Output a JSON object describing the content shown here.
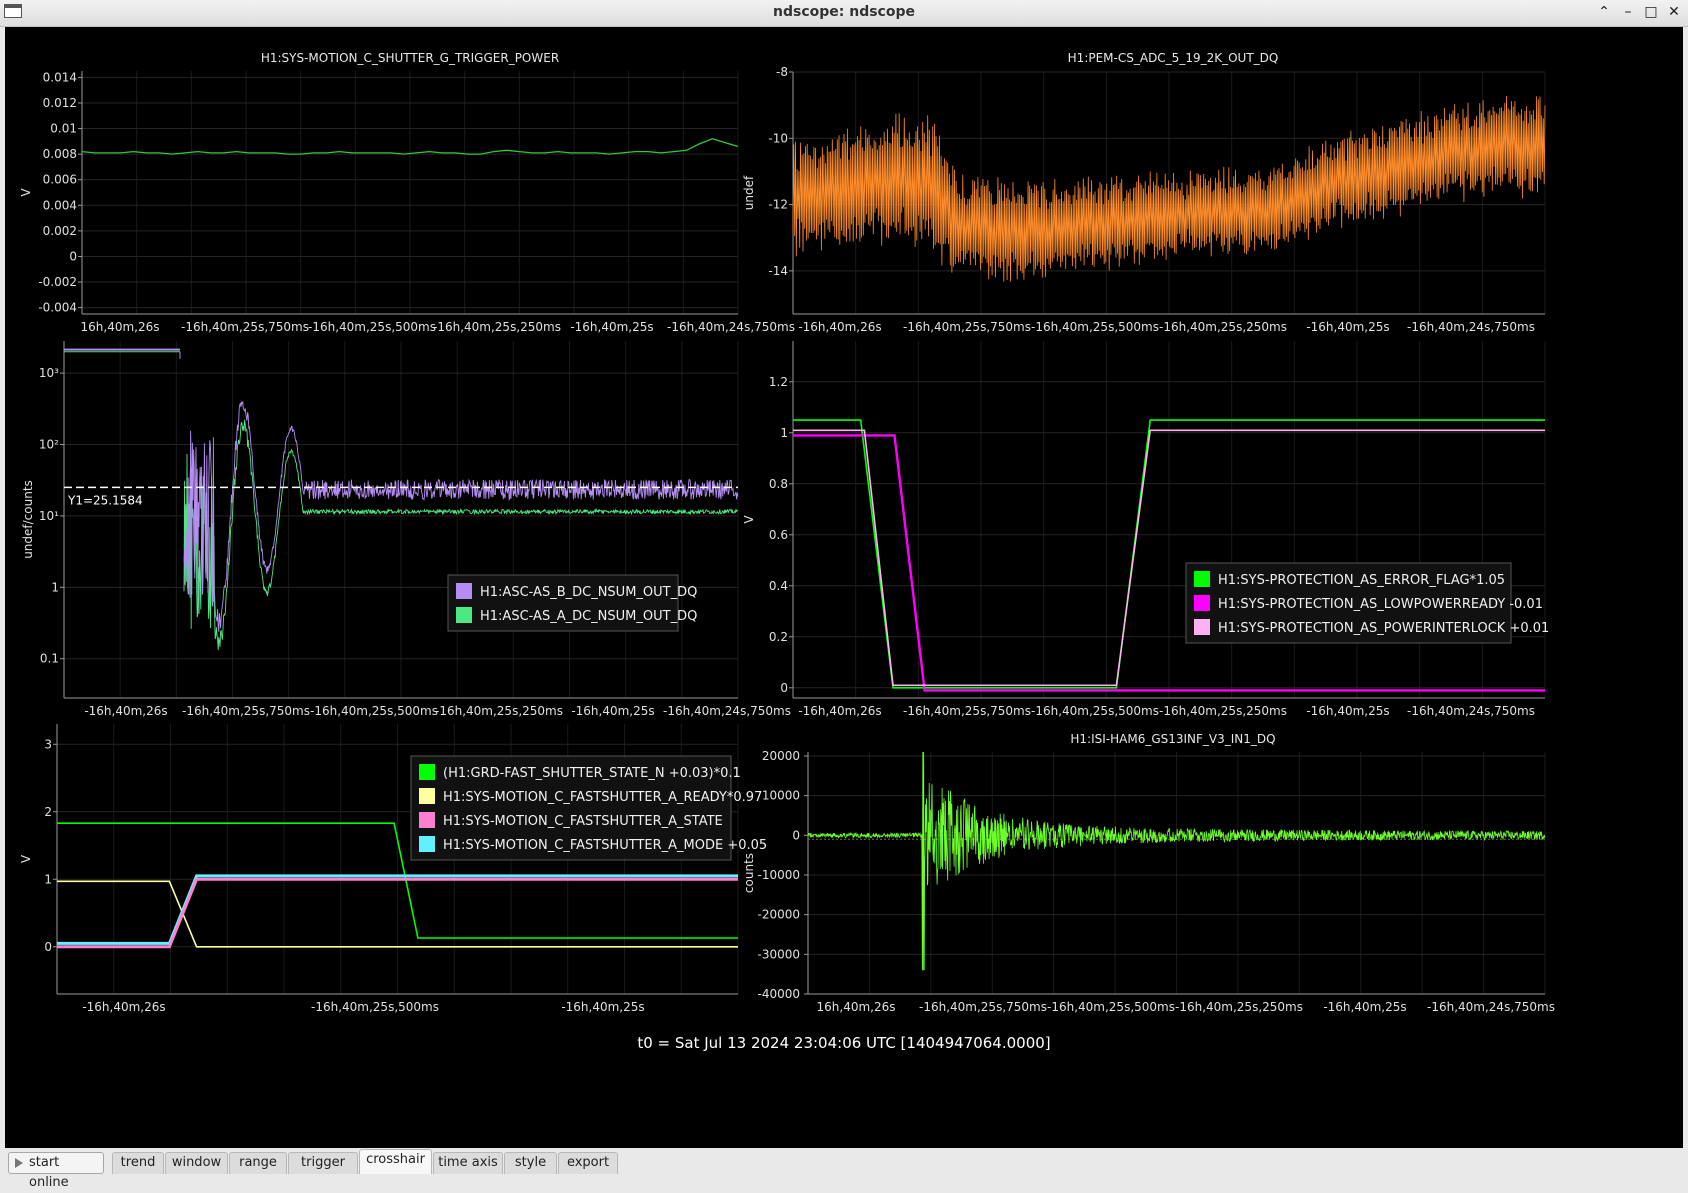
{
  "window": {
    "title": "ndscope: ndscope",
    "controls": [
      "⌃",
      "–",
      "□",
      "✕"
    ]
  },
  "colors": {
    "background": "#000000",
    "trace_green": "#31c83a",
    "trace_orange": "#ff8c2a",
    "trace_violet": "#b48cf2",
    "trace_mint": "#4ee882",
    "bright_green": "#00ff00",
    "magenta": "#ff00ff",
    "pink": "#ffb0f2",
    "yellow": "#ffffa0",
    "rose": "#ff80d0",
    "cyan": "#60f0ff",
    "lime": "#6cff2a"
  },
  "footer": {
    "t0": "t0 = Sat Jul 13 2024 23:04:06 UTC [1404947064.0000]"
  },
  "tabs": [
    {
      "label": "trend"
    },
    {
      "label": "window"
    },
    {
      "label": "range"
    },
    {
      "label": "trigger"
    },
    {
      "label": "crosshair",
      "active": true
    },
    {
      "label": "time axis"
    },
    {
      "label": "style"
    },
    {
      "label": "export"
    }
  ],
  "start_button": {
    "label": "start online"
  },
  "chart_data": [
    {
      "type": "line",
      "title": "H1:SYS-MOTION_C_SHUTTER_G_TRIGGER_POWER",
      "ylabel": "V",
      "yticks": [
        "0.014",
        "0.012",
        "0.01",
        "0.008",
        "0.006",
        "0.004",
        "0.002",
        "0",
        "-0.002",
        "-0.004"
      ],
      "xticks": [
        "16h,40m,26s",
        "-16h,40m,25s,750ms",
        "-16h,40m,25s,500ms",
        "-16h,40m,25s,250ms",
        "-16h,40m,25s",
        "-16h,40m,24s,750ms"
      ],
      "ylim": [
        -0.0045,
        0.0145
      ],
      "series": [
        {
          "color": "#31c83a",
          "values": [
            0.0082,
            0.0081,
            0.0081,
            0.0081,
            0.0082,
            0.0081,
            0.0081,
            0.008,
            0.0081,
            0.0082,
            0.0081,
            0.0081,
            0.0082,
            0.0081,
            0.0081,
            0.0081,
            0.008,
            0.008,
            0.0081,
            0.0081,
            0.0082,
            0.0081,
            0.0081,
            0.0081,
            0.0081,
            0.008,
            0.0081,
            0.0082,
            0.0081,
            0.0081,
            0.008,
            0.008,
            0.0082,
            0.0083,
            0.0082,
            0.0081,
            0.0081,
            0.0082,
            0.0081,
            0.0081,
            0.0081,
            0.008,
            0.0081,
            0.0082,
            0.0082,
            0.0081,
            0.0082,
            0.0083,
            0.0088,
            0.0092,
            0.0089,
            0.0086
          ]
        }
      ]
    },
    {
      "type": "line",
      "title": "H1:PEM-CS_ADC_5_19_2K_OUT_DQ",
      "ylabel": "undef",
      "yticks": [
        "-8",
        "-10",
        "-12",
        "-14"
      ],
      "xticks": [
        "-16h,40m,26s",
        "-16h,40m,25s,750ms",
        "-16h,40m,25s,500ms",
        "-16h,40m,25s,250ms",
        "-16h,40m,25s",
        "-16h,40m,24s,750ms"
      ],
      "ylim": [
        -15.3,
        -8.0
      ],
      "series": [
        {
          "color": "#ff8c2a",
          "trend": [
            [
              0,
              -11.8
            ],
            [
              0.06,
              -11.6
            ],
            [
              0.12,
              -11.2
            ],
            [
              0.18,
              -11.4
            ],
            [
              0.22,
              -12.6
            ],
            [
              0.3,
              -12.8
            ],
            [
              0.4,
              -12.6
            ],
            [
              0.5,
              -12.3
            ],
            [
              0.6,
              -12.2
            ],
            [
              0.66,
              -12.0
            ],
            [
              0.72,
              -11.3
            ],
            [
              0.8,
              -10.9
            ],
            [
              0.88,
              -10.4
            ],
            [
              0.95,
              -10.2
            ],
            [
              1.0,
              -10.3
            ]
          ],
          "amplitude": [
            [
              0,
              1.6
            ],
            [
              0.18,
              2.0
            ],
            [
              0.22,
              1.6
            ],
            [
              0.5,
              1.2
            ],
            [
              0.7,
              1.3
            ],
            [
              1.0,
              1.5
            ]
          ]
        }
      ]
    },
    {
      "type": "line",
      "yscale": "log",
      "ylabel": "undef/counts",
      "yticks": [
        "10³",
        "10²",
        "10¹",
        "1",
        "0.1"
      ],
      "xticks": [
        "-16h,40m,26s",
        "-16h,40m,25s,750ms",
        "-16h,40m,25s,500ms",
        "-16h,40m,25s,250ms",
        "-16h,40m,25s",
        "-16h,40m,24s,750ms"
      ],
      "cursor_label": "Y1=25.1584",
      "cursor_value": 25.1584,
      "legend": [
        {
          "label": "H1:ASC-AS_B_DC_NSUM_OUT_DQ",
          "color": "#b48cf2"
        },
        {
          "label": "H1:ASC-AS_A_DC_NSUM_OUT_DQ",
          "color": "#4ee882"
        }
      ]
    },
    {
      "type": "line",
      "ylabel": "V",
      "yticks": [
        "1.2",
        "1",
        "0.8",
        "0.6",
        "0.4",
        "0.2",
        "0"
      ],
      "xticks": [
        "-16h,40m,26s",
        "-16h,40m,25s,750ms",
        "-16h,40m,25s,500ms",
        "-16h,40m,25s,250ms",
        "-16h,40m,25s",
        "-16h,40m,24s,750ms"
      ],
      "ylim": [
        -0.04,
        1.36
      ],
      "legend": [
        {
          "label": "H1:SYS-PROTECTION_AS_ERROR_FLAG*1.05",
          "color": "#00ff00"
        },
        {
          "label": "H1:SYS-PROTECTION_AS_LOWPOWERREADY -0.01",
          "color": "#ff00ff"
        },
        {
          "label": "H1:SYS-PROTECTION_AS_POWERINTERLOCK +0.01",
          "color": "#ffb0f2"
        }
      ],
      "series": [
        {
          "color": "#00ff00",
          "points": [
            [
              0,
              1.05
            ],
            [
              0.09,
              1.05
            ],
            [
              0.133,
              0
            ],
            [
              0.43,
              0
            ],
            [
              0.475,
              1.05
            ],
            [
              1.0,
              1.05
            ]
          ]
        },
        {
          "color": "#ff00ff",
          "points": [
            [
              0,
              0.99
            ],
            [
              0.135,
              0.99
            ],
            [
              0.175,
              -0.01
            ],
            [
              1.0,
              -0.01
            ]
          ]
        },
        {
          "color": "#ffb0f2",
          "points": [
            [
              0,
              1.01
            ],
            [
              0.095,
              1.01
            ],
            [
              0.133,
              0.01
            ],
            [
              0.43,
              0.01
            ],
            [
              0.475,
              1.01
            ],
            [
              1.0,
              1.01
            ]
          ]
        }
      ]
    },
    {
      "type": "line",
      "ylabel": "V",
      "yticks": [
        "3",
        "2",
        "1",
        "0"
      ],
      "xticks": [
        "-16h,40m,26s",
        "-16h,40m,25s,500ms",
        "-16h,40m,25s"
      ],
      "ylim": [
        -0.7,
        3.3
      ],
      "legend": [
        {
          "label": "(H1:GRD-FAST_SHUTTER_STATE_N +0.03)*0.1",
          "color": "#00ff00"
        },
        {
          "label": "H1:SYS-MOTION_C_FASTSHUTTER_A_READY*0.97",
          "color": "#ffffa0"
        },
        {
          "label": "H1:SYS-MOTION_C_FASTSHUTTER_A_STATE",
          "color": "#ff80d0"
        },
        {
          "label": "H1:SYS-MOTION_C_FASTSHUTTER_A_MODE +0.05",
          "color": "#60f0ff"
        }
      ],
      "series": [
        {
          "color": "#00ff00",
          "points": [
            [
              0,
              1.83
            ],
            [
              0.495,
              1.83
            ],
            [
              0.53,
              0.13
            ],
            [
              1.0,
              0.13
            ]
          ]
        },
        {
          "color": "#ffffa0",
          "points": [
            [
              0,
              0.97
            ],
            [
              0.165,
              0.97
            ],
            [
              0.205,
              0
            ],
            [
              1.0,
              0
            ]
          ]
        },
        {
          "color": "#ff80d0",
          "points": [
            [
              0,
              0.0
            ],
            [
              0.165,
              0.0
            ],
            [
              0.205,
              1.0
            ],
            [
              1.0,
              1.0
            ]
          ]
        },
        {
          "color": "#60f0ff",
          "points": [
            [
              0,
              0.05
            ],
            [
              0.165,
              0.05
            ],
            [
              0.205,
              1.05
            ],
            [
              1.0,
              1.05
            ]
          ]
        }
      ]
    },
    {
      "type": "line",
      "title": "H1:ISI-HAM6_GS13INF_V3_IN1_DQ",
      "ylabel": "counts",
      "yticks": [
        "20000",
        "10000",
        "0",
        "-10000",
        "-20000",
        "-30000",
        "-40000"
      ],
      "xticks": [
        "16h,40m,26s",
        "-16h,40m,25s,750ms",
        "-16h,40m,25s,500ms",
        "-16h,40m,25s,250ms",
        "-16h,40m,25s",
        "-16h,40m,24s,750ms"
      ],
      "ylim": [
        -40000,
        21000
      ],
      "series": [
        {
          "color": "#6cff2a",
          "event_at": 0.155,
          "peak_up": 21000,
          "peak_down": -34000,
          "baseline": 0
        }
      ]
    }
  ]
}
